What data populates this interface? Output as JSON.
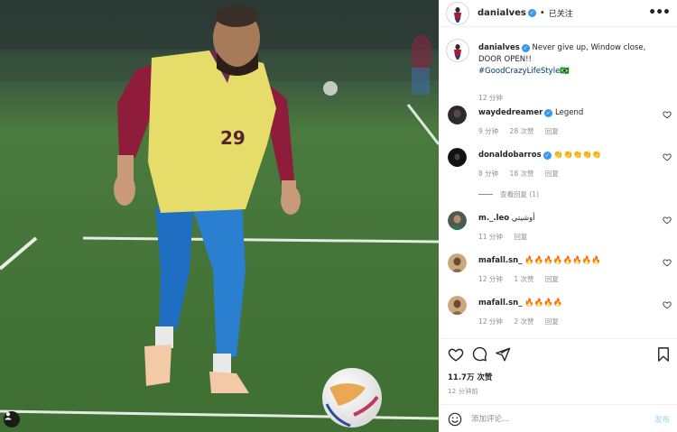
{
  "photo": {
    "description_icon": "user-tag-icon"
  },
  "header": {
    "username": "danialves",
    "separator": "•",
    "follow_state": "已关注",
    "more": "•••"
  },
  "caption": {
    "username": "danialves",
    "text": "Never give up, Window close, DOOR OPEN!!",
    "hashtag": "#GoodCrazyLifeStyle🇧🇷",
    "time": "12 分钟"
  },
  "comments": [
    {
      "username": "waydedreamer",
      "verified": true,
      "text": "Legend",
      "time": "9 分钟",
      "likes": "28 次赞",
      "reply": "回复"
    },
    {
      "username": "donaldobarros",
      "verified": true,
      "text": "👏👏👏👏👏",
      "time": "8 分钟",
      "likes": "18 次赞",
      "reply": "回复",
      "view_replies": "查看回复 (1)"
    },
    {
      "username": "m._.leo",
      "verified": false,
      "text": "أوشيتي",
      "time": "11 分钟",
      "likes": "",
      "reply": "回复"
    },
    {
      "username": "mafall.sn_",
      "verified": false,
      "text": "🔥🔥🔥🔥🔥🔥🔥🔥",
      "time": "12 分钟",
      "likes": "1 次赞",
      "reply": "回复"
    },
    {
      "username": "mafall.sn_",
      "verified": false,
      "text": "🔥🔥🔥🔥",
      "time": "12 分钟",
      "likes": "2 次赞",
      "reply": "回复"
    }
  ],
  "actions": {
    "likes": "11.7万 次赞",
    "post_time": "12 分钟前"
  },
  "add_comment": {
    "placeholder": "添加评论...",
    "post_label": "发布"
  },
  "colors": {
    "verified": "#3897f0",
    "link": "#00376b",
    "muted": "#8e8e8e",
    "post_disabled": "#b2dffc"
  }
}
